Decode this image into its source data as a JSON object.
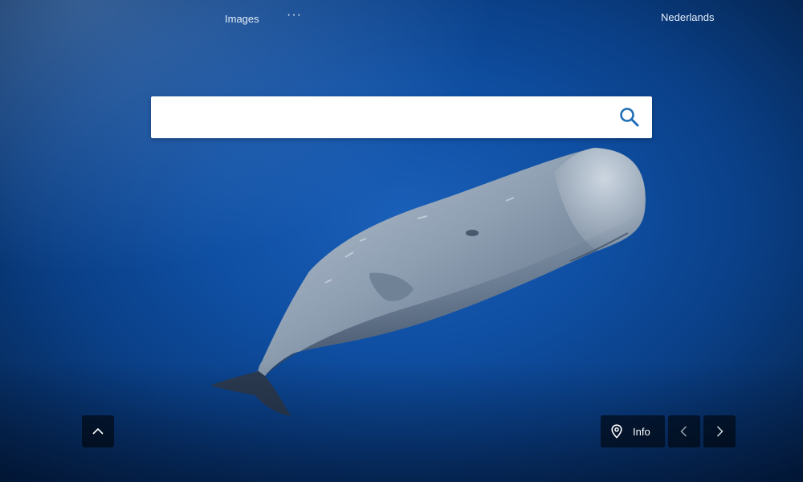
{
  "nav": {
    "images_label": "Images",
    "more_label": "···",
    "language_label": "Nederlands"
  },
  "search": {
    "value": "",
    "placeholder": "",
    "icon": "search-icon"
  },
  "background": {
    "subject": "sperm whale",
    "accent": "#0f4fa3"
  },
  "controls": {
    "scroll_up_icon": "chevron-up-icon",
    "info_label": "Info",
    "info_icon": "location-pin-icon",
    "prev_icon": "chevron-left-icon",
    "next_icon": "chevron-right-icon"
  }
}
